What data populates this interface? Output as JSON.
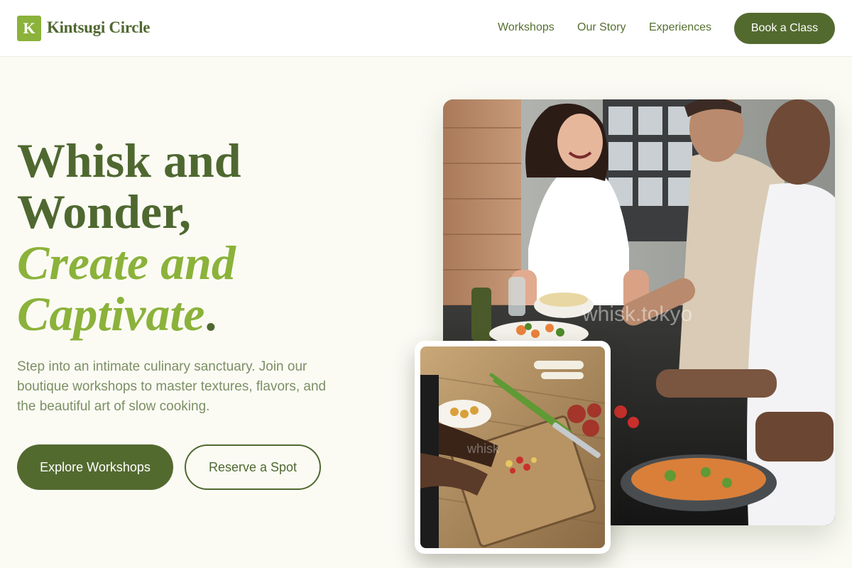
{
  "brand": {
    "mark": "K",
    "name": "Kintsugi Circle"
  },
  "nav": {
    "items": [
      {
        "label": "Workshops"
      },
      {
        "label": "Our Story"
      },
      {
        "label": "Experiences"
      }
    ],
    "cta": "Book a Class"
  },
  "hero": {
    "line1": "Whisk and",
    "line2": "Wonder,",
    "line3": "Create and",
    "line4": "Captivate",
    "line4_end": ".",
    "subtext": "Step into an intimate culinary sanctuary. Join our boutique workshops to master textures, flavors, and the beautiful art of slow cooking.",
    "primary_button": "Explore Workshops",
    "secondary_button": "Reserve a Spot"
  },
  "images": {
    "main_watermark": "whisk.tokyo",
    "card_watermark": "whisk"
  },
  "colors": {
    "brand_dark": "#536a2f",
    "brand_light": "#8bb23a",
    "background": "#fbfbf4"
  }
}
